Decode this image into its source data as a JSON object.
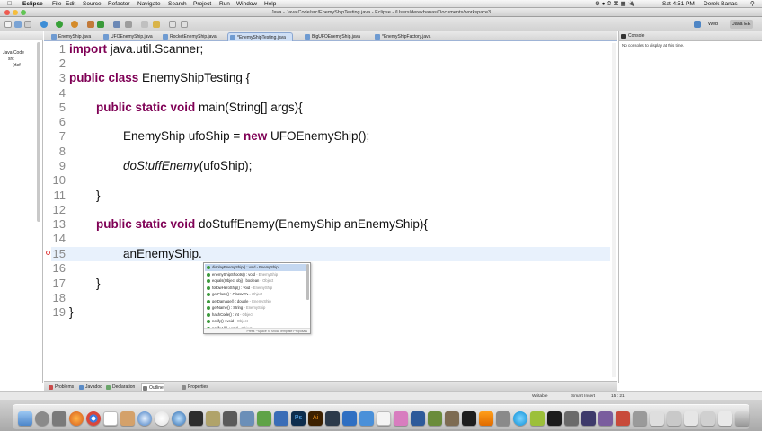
{
  "menubar": {
    "app": "Eclipse",
    "items": [
      "File",
      "Edit",
      "Source",
      "Refactor",
      "Navigate",
      "Search",
      "Project",
      "Run",
      "Window",
      "Help"
    ],
    "clock": "Sat 4:51 PM",
    "user": "Derek Banas"
  },
  "window": {
    "title": "Java - Java Code/src/EnemyShipTesting.java - Eclipse - /Users/derekbanas/Documents/workspace3"
  },
  "toolbar": {
    "perspectives": [
      "Web",
      "Java EE"
    ]
  },
  "package_explorer": {
    "project": "Java Code",
    "nodes": [
      "src",
      "(def"
    ]
  },
  "editor": {
    "tabs": [
      {
        "label": "EnemyShip.java",
        "active": false
      },
      {
        "label": "UFOEnemyShip.java",
        "active": false
      },
      {
        "label": "RocketEnemyShip.java",
        "active": false
      },
      {
        "label": "*EnemyShipTesting.java",
        "active": true
      },
      {
        "label": "BigUFOEnemyShip.java",
        "active": false
      },
      {
        "label": "*EnemyShipFactory.java",
        "active": false
      }
    ],
    "line_numbers": [
      "1",
      "2",
      "3",
      "4",
      "5",
      "6",
      "7",
      "8",
      "9",
      "10",
      "11",
      "12",
      "13",
      "14",
      "15",
      "16",
      "17",
      "18",
      "19"
    ],
    "code": {
      "l1_kw": "import",
      "l1_rest": " java.util.Scanner;",
      "l3_kw": "public class",
      "l3_rest": " EnemyShipTesting {",
      "l5_kw": "public static void",
      "l5_rest": " main(String[] args){",
      "l7_a": "EnemyShip ufoShip = ",
      "l7_kw": "new",
      "l7_b": " UFOEnemyShip();",
      "l9_it": "doStuffEnemy",
      "l9_rest": "(ufoShip);",
      "l11": "}",
      "l13_kw": "public static void",
      "l13_rest": " doStuffEnemy(EnemyShip anEnemyShip){",
      "l15": "anEnemyShip.",
      "l17": "}",
      "l19": "}"
    }
  },
  "content_assist": {
    "items": [
      {
        "sig": "displayEnemyShip() : void",
        "ret": " - EnemyShip"
      },
      {
        "sig": "enemyShipShoots() : void",
        "ret": " - EnemyShip"
      },
      {
        "sig": "equals(Object obj) : boolean",
        "ret": " - Object"
      },
      {
        "sig": "followHeroShip() : void",
        "ret": " - EnemyShip"
      },
      {
        "sig": "getClass() : Class<?>",
        "ret": " - Object"
      },
      {
        "sig": "getDamage() : double",
        "ret": " - EnemyShip"
      },
      {
        "sig": "getName() : String",
        "ret": " - EnemyShip"
      },
      {
        "sig": "hashCode() : int",
        "ret": " - Object"
      },
      {
        "sig": "notify() : void",
        "ret": " - Object"
      },
      {
        "sig": "notifyAll() : void",
        "ret": " - Object"
      }
    ],
    "footer": "Press '^Space' to show Template Proposals"
  },
  "console": {
    "tab": "Console",
    "message": "No consoles to display at this time."
  },
  "bottom_tabs": [
    "Problems",
    "Javadoc",
    "Declaration",
    "Outline",
    "Properties"
  ],
  "statusbar": {
    "writable": "Writable",
    "insert_mode": "Smart Insert",
    "position": "15 : 21"
  },
  "dock_icons": [
    "finder-icon",
    "launchpad-icon",
    "firefox-icon",
    "chrome-icon",
    "calendar-icon",
    "contacts-icon",
    "safari-icon",
    "itunes-icon",
    "preview-icon",
    "photos-icon",
    "sketch-icon",
    "iphoto-icon",
    "photoshop-icon",
    "illustrator-icon",
    "bridge-icon",
    "xcode-icon",
    "tools-icon",
    "textedit-icon",
    "minecraft-icon",
    "film-icon",
    "vlc-icon",
    "skype-icon",
    "gear-icon",
    "camtasia-icon",
    "terminal-icon",
    "webcam-icon",
    "eclipse-icon",
    "window-1",
    "window-2",
    "window-3",
    "window-4",
    "trash-icon"
  ],
  "colors": {
    "keyword": "#7f0055",
    "current_line": "#e8f1fc",
    "selection": "#c4d7f0"
  }
}
